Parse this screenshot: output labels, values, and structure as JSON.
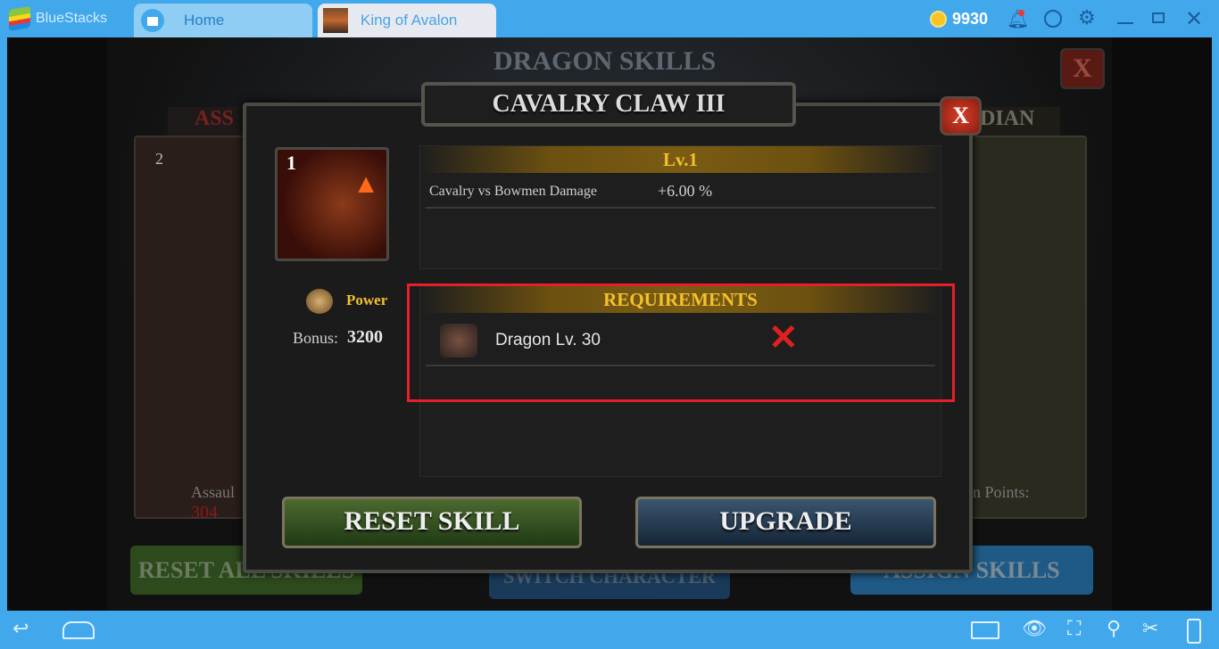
{
  "app": {
    "name": "BlueStacks",
    "tabs": [
      {
        "label": "Home",
        "icon": "home-icon"
      },
      {
        "label": "King of Avalon",
        "icon": "game-thumbnail"
      }
    ],
    "coins": "9930",
    "colors": {
      "chrome": "#42a8ec",
      "accent_gold": "#f3c12e",
      "highlight_red": "#e5202a"
    }
  },
  "background": {
    "title": "DRAGON SKILLS",
    "left_tab": "ASS",
    "right_tab": "DIAN",
    "card_level": "2",
    "left_stat_label": "Assaul",
    "left_stat_value": "304",
    "right_stat_label": "n Points:",
    "buttons": [
      "RESET ALL SKILLS",
      "SWITCH CHARACTER",
      "ASSIGN SKILLS"
    ],
    "close": "X"
  },
  "modal": {
    "title": "CAVALRY CLAW III",
    "close": "X",
    "skill_level_badge": "1",
    "level_header": "Lv.1",
    "effect_label": "Cavalry vs Bowmen Damage",
    "effect_value": "+6.00 %",
    "power_label": "Power",
    "bonus_label": "Bonus:",
    "bonus_value": "3200",
    "requirements_header": "REQUIREMENTS",
    "requirement": {
      "label": "Dragon Lv. 30",
      "met": false
    },
    "reset_button": "RESET SKILL",
    "upgrade_button": "UPGRADE"
  }
}
